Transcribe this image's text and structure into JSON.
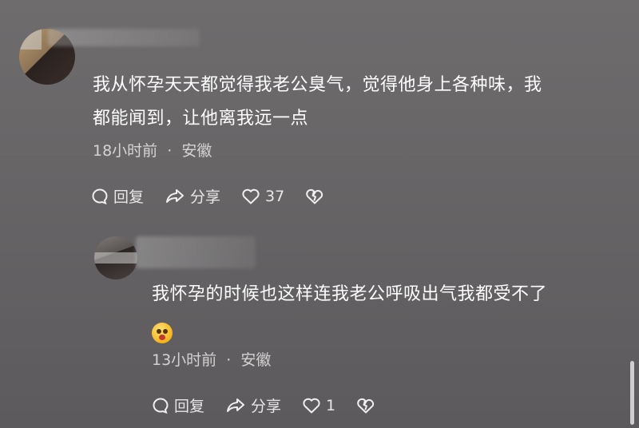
{
  "comments": [
    {
      "text_line1": "我从怀孕天天都觉得我老公臭气，觉得他身上各种味，我",
      "text_line2": "都能闻到，让他离我远一点",
      "time": "18小时前",
      "location": "安徽",
      "reply_label": "回复",
      "share_label": "分享",
      "like_count": "37"
    },
    {
      "text_line1": "我怀孕的时候也这样连我老公呼吸出气我都受不了",
      "emoji": "astonished-face-emoji",
      "time": "13小时前",
      "location": "安徽",
      "reply_label": "回复",
      "share_label": "分享",
      "like_count": "1"
    }
  ],
  "separator": "·",
  "icons": [
    "comment-icon",
    "share-icon",
    "heart-icon",
    "dislike-heart-icon"
  ]
}
